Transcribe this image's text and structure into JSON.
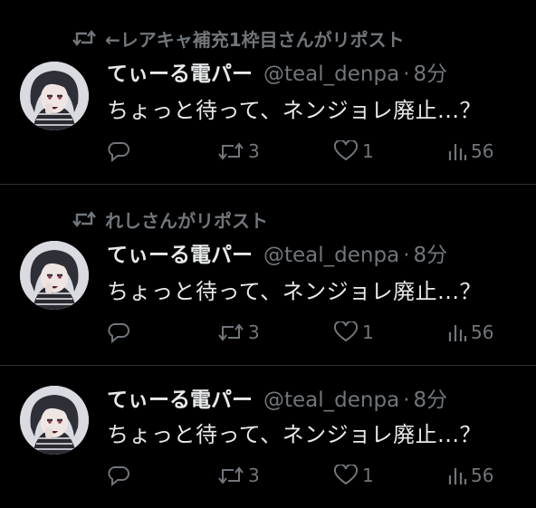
{
  "tweets": [
    {
      "repost_label": "←レアキャ補充1枠目さんがリポスト",
      "name": "てぃーる電パー",
      "handle": "@teal_denpa",
      "dot": "·",
      "time": "8分",
      "text": "ちょっと待って、ネンジョレ廃止...？",
      "retweets": "3",
      "likes": "1",
      "views": "56"
    },
    {
      "repost_label": "れしさんがリポスト",
      "name": "てぃーる電パー",
      "handle": "@teal_denpa",
      "dot": "·",
      "time": "8分",
      "text": "ちょっと待って、ネンジョレ廃止...？",
      "retweets": "3",
      "likes": "1",
      "views": "56"
    },
    {
      "repost_label": null,
      "name": "てぃーる電パー",
      "handle": "@teal_denpa",
      "dot": "·",
      "time": "8分",
      "text": "ちょっと待って、ネンジョレ廃止...？",
      "retweets": "3",
      "likes": "1",
      "views": "56"
    }
  ],
  "icons": {
    "repost": "repost-icon",
    "reply": "reply-icon",
    "retweet": "retweet-icon",
    "like": "heart-icon",
    "views": "views-icon",
    "avatar": "avatar"
  },
  "colors": {
    "background": "#000000",
    "text": "#e7e9ea",
    "muted": "#71767b",
    "divider": "#2f3336"
  }
}
